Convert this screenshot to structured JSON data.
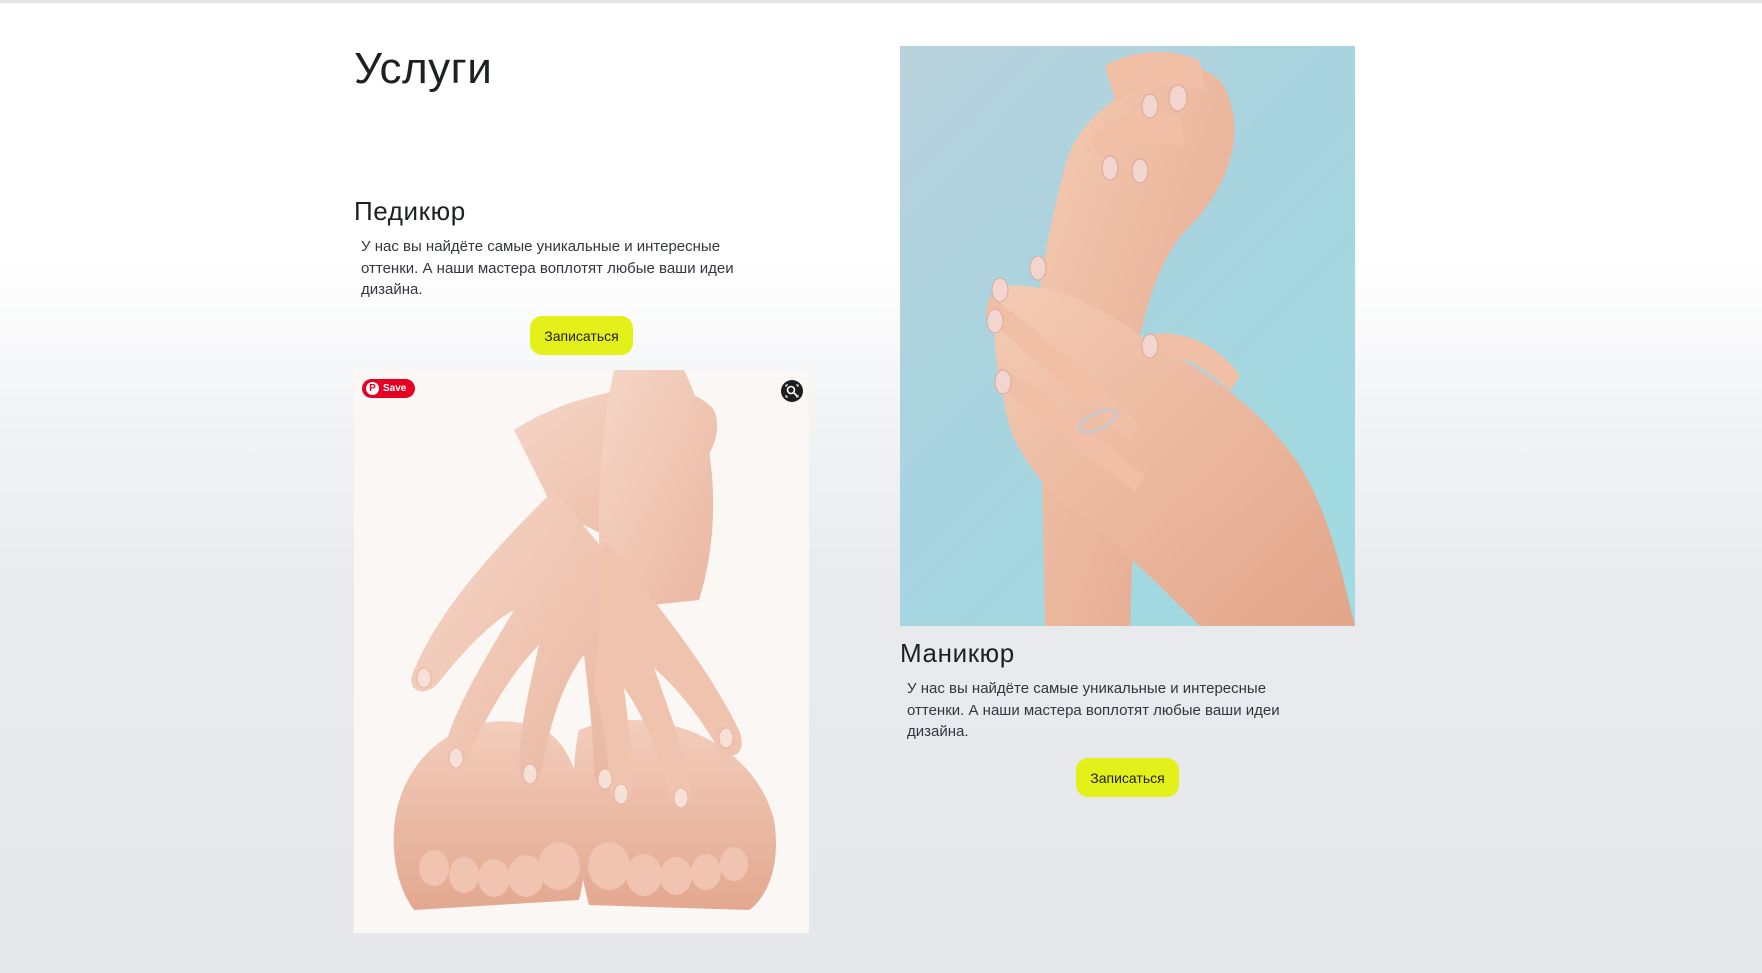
{
  "section": {
    "title": "Услуги"
  },
  "services": [
    {
      "title": "Педикюр",
      "description": "У нас вы найдёте самые уникальные и интересные оттенки. А наши мастера воплотят любые ваши идеи дизайна.",
      "button": "Записаться",
      "image_overlay": {
        "save_label": "Save"
      }
    },
    {
      "title": "Маникюр",
      "description": "У нас вы найдёте самые уникальные и интересные оттенки. А наши мастера воплотят любые ваши идеи дизайна.",
      "button": "Записаться"
    }
  ],
  "colors": {
    "button_bg": "#e4f01a",
    "pinterest": "#e60023",
    "text": "#222428"
  },
  "icons": {
    "pinterest": "pinterest-icon",
    "visual_search": "visual-search-icon"
  }
}
